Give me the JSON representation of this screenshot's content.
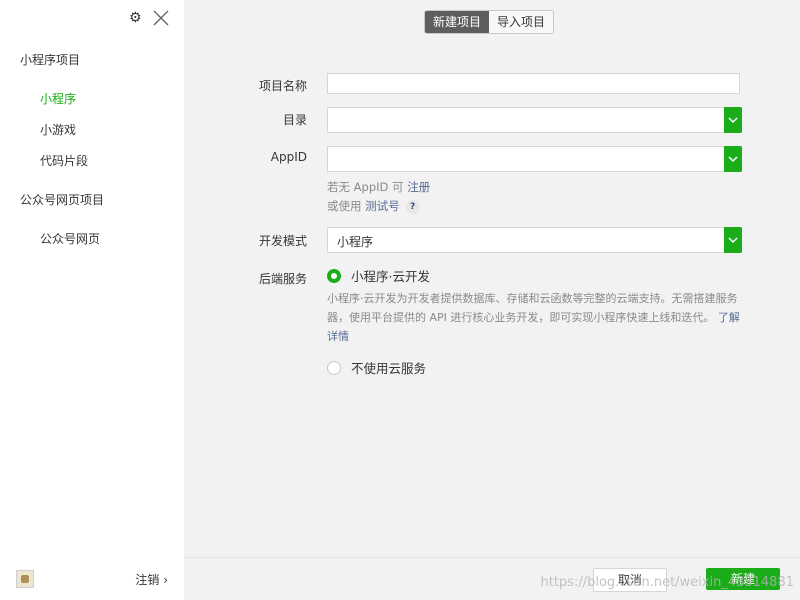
{
  "sidebar": {
    "groups": [
      {
        "title": "小程序项目",
        "items": [
          "小程序",
          "小游戏",
          "代码片段"
        ]
      },
      {
        "title": "公众号网页项目",
        "items": [
          "公众号网页"
        ]
      }
    ],
    "active_item": "小程序",
    "logout_label": "注销 ›"
  },
  "tabs": {
    "new_label": "新建项目",
    "import_label": "导入项目",
    "active": "新建项目"
  },
  "form": {
    "name_label": "项目名称",
    "name_value": "",
    "dir_label": "目录",
    "dir_value": "",
    "appid_label": "AppID",
    "appid_value": "",
    "appid_hint_prefix": "若无 AppID 可 ",
    "appid_hint_link": "注册",
    "test_hint_prefix": "或使用 ",
    "test_hint_link": "测试号",
    "help_icon": "?",
    "mode_label": "开发模式",
    "mode_value": "小程序",
    "backend_label": "后端服务",
    "option_cloud": "小程序·云开发",
    "option_cloud_desc": "小程序·云开发为开发者提供数据库、存储和云函数等完整的云端支持。无需搭建服务器，使用平台提供的 API 进行核心业务开发，即可实现小程序快速上线和迭代。",
    "option_cloud_link": "了解详情",
    "option_none": "不使用云服务",
    "selected_option": "小程序·云开发"
  },
  "footer": {
    "cancel_label": "取消",
    "create_label": "新建"
  },
  "watermark": "https://blog.csdn.net/weixin_43314881",
  "colors": {
    "accent": "#1aad19",
    "link": "#576b95",
    "tab_active": "#5e5e5e"
  }
}
